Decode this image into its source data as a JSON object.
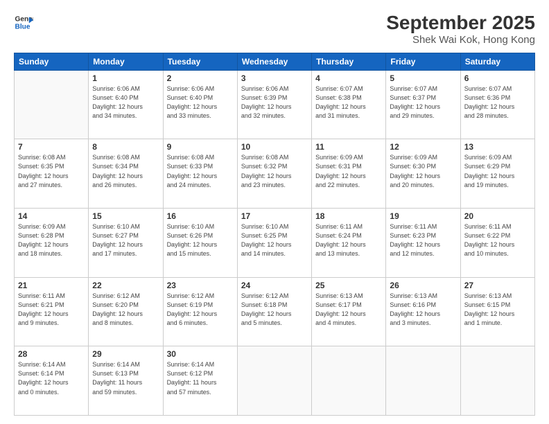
{
  "logo": {
    "line1": "General",
    "line2": "Blue"
  },
  "title": "September 2025",
  "location": "Shek Wai Kok, Hong Kong",
  "days_header": [
    "Sunday",
    "Monday",
    "Tuesday",
    "Wednesday",
    "Thursday",
    "Friday",
    "Saturday"
  ],
  "weeks": [
    [
      {
        "day": "",
        "info": ""
      },
      {
        "day": "1",
        "info": "Sunrise: 6:06 AM\nSunset: 6:40 PM\nDaylight: 12 hours\nand 34 minutes."
      },
      {
        "day": "2",
        "info": "Sunrise: 6:06 AM\nSunset: 6:40 PM\nDaylight: 12 hours\nand 33 minutes."
      },
      {
        "day": "3",
        "info": "Sunrise: 6:06 AM\nSunset: 6:39 PM\nDaylight: 12 hours\nand 32 minutes."
      },
      {
        "day": "4",
        "info": "Sunrise: 6:07 AM\nSunset: 6:38 PM\nDaylight: 12 hours\nand 31 minutes."
      },
      {
        "day": "5",
        "info": "Sunrise: 6:07 AM\nSunset: 6:37 PM\nDaylight: 12 hours\nand 29 minutes."
      },
      {
        "day": "6",
        "info": "Sunrise: 6:07 AM\nSunset: 6:36 PM\nDaylight: 12 hours\nand 28 minutes."
      }
    ],
    [
      {
        "day": "7",
        "info": "Sunrise: 6:08 AM\nSunset: 6:35 PM\nDaylight: 12 hours\nand 27 minutes."
      },
      {
        "day": "8",
        "info": "Sunrise: 6:08 AM\nSunset: 6:34 PM\nDaylight: 12 hours\nand 26 minutes."
      },
      {
        "day": "9",
        "info": "Sunrise: 6:08 AM\nSunset: 6:33 PM\nDaylight: 12 hours\nand 24 minutes."
      },
      {
        "day": "10",
        "info": "Sunrise: 6:08 AM\nSunset: 6:32 PM\nDaylight: 12 hours\nand 23 minutes."
      },
      {
        "day": "11",
        "info": "Sunrise: 6:09 AM\nSunset: 6:31 PM\nDaylight: 12 hours\nand 22 minutes."
      },
      {
        "day": "12",
        "info": "Sunrise: 6:09 AM\nSunset: 6:30 PM\nDaylight: 12 hours\nand 20 minutes."
      },
      {
        "day": "13",
        "info": "Sunrise: 6:09 AM\nSunset: 6:29 PM\nDaylight: 12 hours\nand 19 minutes."
      }
    ],
    [
      {
        "day": "14",
        "info": "Sunrise: 6:09 AM\nSunset: 6:28 PM\nDaylight: 12 hours\nand 18 minutes."
      },
      {
        "day": "15",
        "info": "Sunrise: 6:10 AM\nSunset: 6:27 PM\nDaylight: 12 hours\nand 17 minutes."
      },
      {
        "day": "16",
        "info": "Sunrise: 6:10 AM\nSunset: 6:26 PM\nDaylight: 12 hours\nand 15 minutes."
      },
      {
        "day": "17",
        "info": "Sunrise: 6:10 AM\nSunset: 6:25 PM\nDaylight: 12 hours\nand 14 minutes."
      },
      {
        "day": "18",
        "info": "Sunrise: 6:11 AM\nSunset: 6:24 PM\nDaylight: 12 hours\nand 13 minutes."
      },
      {
        "day": "19",
        "info": "Sunrise: 6:11 AM\nSunset: 6:23 PM\nDaylight: 12 hours\nand 12 minutes."
      },
      {
        "day": "20",
        "info": "Sunrise: 6:11 AM\nSunset: 6:22 PM\nDaylight: 12 hours\nand 10 minutes."
      }
    ],
    [
      {
        "day": "21",
        "info": "Sunrise: 6:11 AM\nSunset: 6:21 PM\nDaylight: 12 hours\nand 9 minutes."
      },
      {
        "day": "22",
        "info": "Sunrise: 6:12 AM\nSunset: 6:20 PM\nDaylight: 12 hours\nand 8 minutes."
      },
      {
        "day": "23",
        "info": "Sunrise: 6:12 AM\nSunset: 6:19 PM\nDaylight: 12 hours\nand 6 minutes."
      },
      {
        "day": "24",
        "info": "Sunrise: 6:12 AM\nSunset: 6:18 PM\nDaylight: 12 hours\nand 5 minutes."
      },
      {
        "day": "25",
        "info": "Sunrise: 6:13 AM\nSunset: 6:17 PM\nDaylight: 12 hours\nand 4 minutes."
      },
      {
        "day": "26",
        "info": "Sunrise: 6:13 AM\nSunset: 6:16 PM\nDaylight: 12 hours\nand 3 minutes."
      },
      {
        "day": "27",
        "info": "Sunrise: 6:13 AM\nSunset: 6:15 PM\nDaylight: 12 hours\nand 1 minute."
      }
    ],
    [
      {
        "day": "28",
        "info": "Sunrise: 6:14 AM\nSunset: 6:14 PM\nDaylight: 12 hours\nand 0 minutes."
      },
      {
        "day": "29",
        "info": "Sunrise: 6:14 AM\nSunset: 6:13 PM\nDaylight: 11 hours\nand 59 minutes."
      },
      {
        "day": "30",
        "info": "Sunrise: 6:14 AM\nSunset: 6:12 PM\nDaylight: 11 hours\nand 57 minutes."
      },
      {
        "day": "",
        "info": ""
      },
      {
        "day": "",
        "info": ""
      },
      {
        "day": "",
        "info": ""
      },
      {
        "day": "",
        "info": ""
      }
    ]
  ]
}
